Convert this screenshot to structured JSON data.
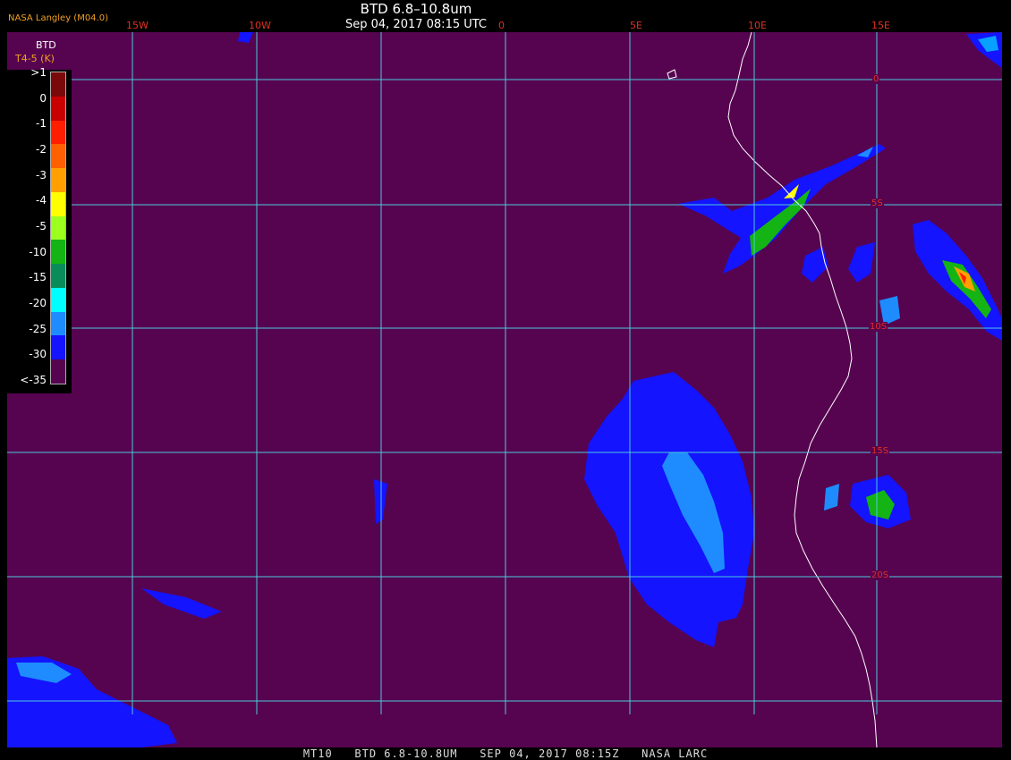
{
  "header": {
    "title": "BTD 6.8–10.8um",
    "timestamp": "Sep 04, 2017 08:15 UTC",
    "credit": "NASA Langley (M04.0)"
  },
  "grid": {
    "lon_labels": [
      "15W",
      "10W",
      "0",
      "5E",
      "10E",
      "15E"
    ],
    "lat_labels": [
      "0",
      "5S",
      "10S",
      "15S",
      "20S"
    ]
  },
  "legend": {
    "title": "BTD",
    "unit": "T4-5 (K)",
    "ticks": [
      ">1",
      "0",
      "-1",
      "-2",
      "-3",
      "-4",
      "-5",
      "-10",
      "-15",
      "-20",
      "-25",
      "-30",
      "<-35"
    ],
    "colors": [
      "#7a0a0a",
      "#c80000",
      "#ff1e00",
      "#ff6000",
      "#ffa000",
      "#ffff00",
      "#9cff1e",
      "#14b414",
      "#0a8c5a",
      "#00ffff",
      "#1e8cff",
      "#1414ff",
      "#560450"
    ]
  },
  "footer": "MT10   BTD 6.8-10.8UM   SEP 04, 2017 08:15Z   NASA LARC",
  "colors": {
    "background": "#560450",
    "gridline": "#4cc8dc",
    "coastline": "#ffffff",
    "label": "#e03020"
  }
}
